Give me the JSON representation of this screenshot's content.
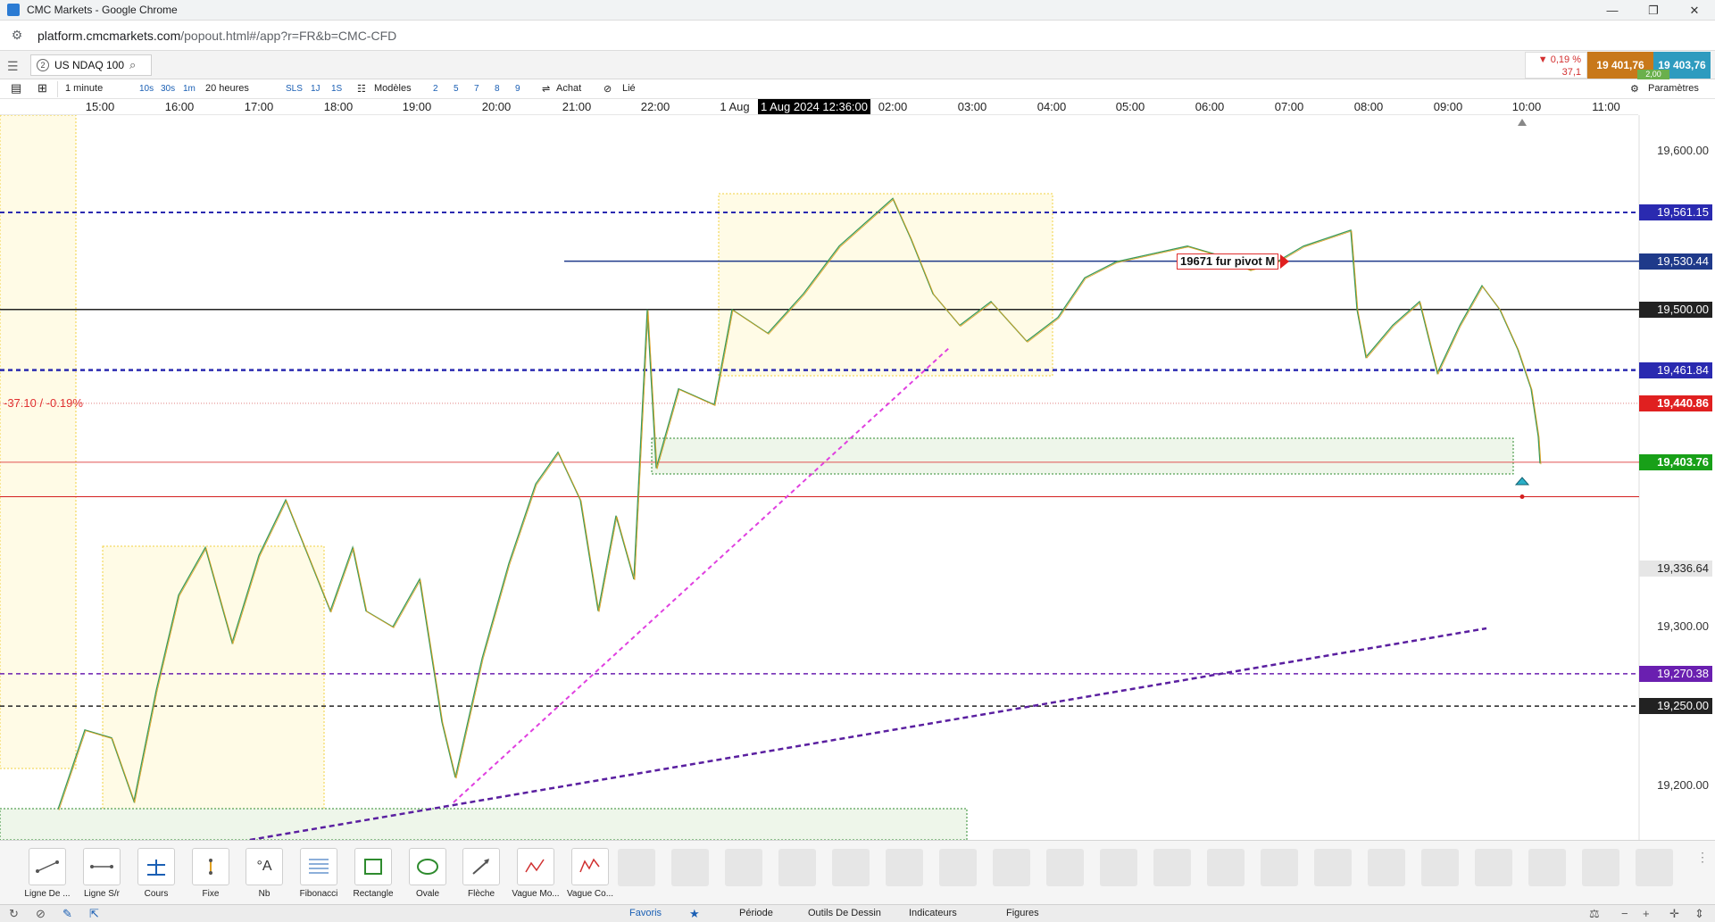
{
  "browser": {
    "window_title": "CMC Markets - Google Chrome",
    "url_host": "platform.cmcmarkets.com",
    "url_path": "/popout.html#/app?r=FR&b=CMC-CFD"
  },
  "instrument": {
    "tab_number": "2",
    "name": "US NDAQ 100",
    "change_pct": "▼ 0,19 %",
    "change_pts": "37,1",
    "sell_price": "19 401,76",
    "buy_price": "19 403,76",
    "spread": "2,00"
  },
  "chart_toolbar": {
    "interval": "1 minute",
    "btn_10s": "10s",
    "btn_30s": "30s",
    "btn_1m": "1m",
    "range": "20 heures",
    "btn_sls": "SLS",
    "btn_1j": "1J",
    "btn_1s": "1S",
    "models": "Modèles",
    "n2": "2",
    "n5": "5",
    "n7": "7",
    "n8": "8",
    "n9": "9",
    "buy": "Achat",
    "linked": "Lié",
    "settings": "Paramètres"
  },
  "time_axis": {
    "labels": [
      "15:00",
      "16:00",
      "17:00",
      "18:00",
      "19:00",
      "20:00",
      "21:00",
      "22:00",
      "1 Aug",
      "02:00",
      "03:00",
      "04:00",
      "05:00",
      "06:00",
      "07:00",
      "08:00",
      "09:00",
      "10:00",
      "11:00"
    ],
    "cursor": "1 Aug 2024 12:36:00"
  },
  "price_axis": {
    "ticks": [
      "19,600.00",
      "19,300.00",
      "19,200.00"
    ],
    "levels": {
      "l1": "19,561.15",
      "l2": "19,530.44",
      "l3": "19,500.00",
      "l4": "19,461.84",
      "l5": "19,440.86",
      "l6": "19,403.76",
      "l7": "19,336.64",
      "l8": "19,270.38",
      "l9": "19,250.00"
    }
  },
  "annotations": {
    "change": "-37.10 / -0.19%",
    "pivot": "19671 fur pivot M"
  },
  "colors": {
    "sell": "#c8781a",
    "buy": "#2e9bbf",
    "up_candle": "#2e8b57",
    "down_candle": "#e0a020",
    "accent": "#1a5fb4"
  },
  "tools": [
    {
      "label": "Ligne De ...",
      "icon": "trend-line-icon"
    },
    {
      "label": "Ligne S/r",
      "icon": "sr-line-icon"
    },
    {
      "label": "Cours",
      "icon": "price-icon"
    },
    {
      "label": "Fixe",
      "icon": "fixed-icon"
    },
    {
      "label": "Nb",
      "icon": "text-icon"
    },
    {
      "label": "Fibonacci",
      "icon": "fibonacci-icon"
    },
    {
      "label": "Rectangle",
      "icon": "rectangle-icon"
    },
    {
      "label": "Ovale",
      "icon": "oval-icon"
    },
    {
      "label": "Flèche",
      "icon": "arrow-icon"
    },
    {
      "label": "Vague Mo...",
      "icon": "wave-icon"
    },
    {
      "label": "Vague Co...",
      "icon": "wave2-icon"
    }
  ],
  "bottom_tabs": {
    "favoris": "Favoris",
    "periode": "Période",
    "outils": "Outils De Dessin",
    "indicateurs": "Indicateurs",
    "figures": "Figures"
  }
}
